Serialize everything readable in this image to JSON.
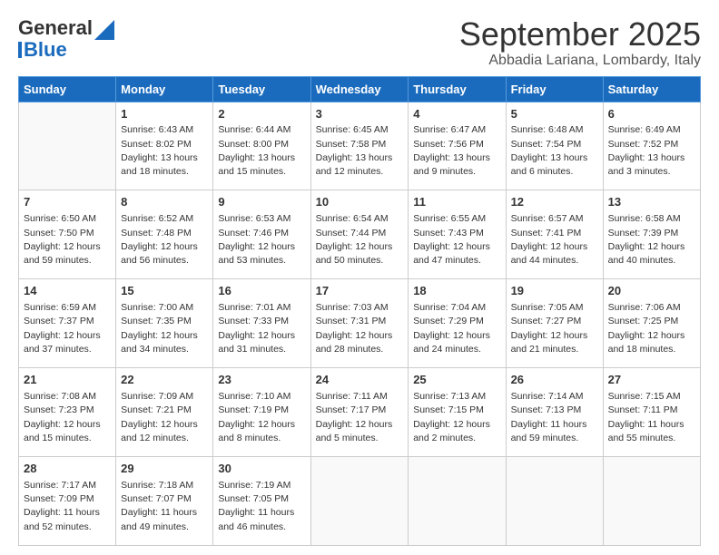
{
  "logo": {
    "line1": "General",
    "line2": "Blue"
  },
  "title": "September 2025",
  "subtitle": "Abbadia Lariana, Lombardy, Italy",
  "days_of_week": [
    "Sunday",
    "Monday",
    "Tuesday",
    "Wednesday",
    "Thursday",
    "Friday",
    "Saturday"
  ],
  "weeks": [
    [
      {
        "day": "",
        "info": ""
      },
      {
        "day": "1",
        "info": "Sunrise: 6:43 AM\nSunset: 8:02 PM\nDaylight: 13 hours\nand 18 minutes."
      },
      {
        "day": "2",
        "info": "Sunrise: 6:44 AM\nSunset: 8:00 PM\nDaylight: 13 hours\nand 15 minutes."
      },
      {
        "day": "3",
        "info": "Sunrise: 6:45 AM\nSunset: 7:58 PM\nDaylight: 13 hours\nand 12 minutes."
      },
      {
        "day": "4",
        "info": "Sunrise: 6:47 AM\nSunset: 7:56 PM\nDaylight: 13 hours\nand 9 minutes."
      },
      {
        "day": "5",
        "info": "Sunrise: 6:48 AM\nSunset: 7:54 PM\nDaylight: 13 hours\nand 6 minutes."
      },
      {
        "day": "6",
        "info": "Sunrise: 6:49 AM\nSunset: 7:52 PM\nDaylight: 13 hours\nand 3 minutes."
      }
    ],
    [
      {
        "day": "7",
        "info": "Sunrise: 6:50 AM\nSunset: 7:50 PM\nDaylight: 12 hours\nand 59 minutes."
      },
      {
        "day": "8",
        "info": "Sunrise: 6:52 AM\nSunset: 7:48 PM\nDaylight: 12 hours\nand 56 minutes."
      },
      {
        "day": "9",
        "info": "Sunrise: 6:53 AM\nSunset: 7:46 PM\nDaylight: 12 hours\nand 53 minutes."
      },
      {
        "day": "10",
        "info": "Sunrise: 6:54 AM\nSunset: 7:44 PM\nDaylight: 12 hours\nand 50 minutes."
      },
      {
        "day": "11",
        "info": "Sunrise: 6:55 AM\nSunset: 7:43 PM\nDaylight: 12 hours\nand 47 minutes."
      },
      {
        "day": "12",
        "info": "Sunrise: 6:57 AM\nSunset: 7:41 PM\nDaylight: 12 hours\nand 44 minutes."
      },
      {
        "day": "13",
        "info": "Sunrise: 6:58 AM\nSunset: 7:39 PM\nDaylight: 12 hours\nand 40 minutes."
      }
    ],
    [
      {
        "day": "14",
        "info": "Sunrise: 6:59 AM\nSunset: 7:37 PM\nDaylight: 12 hours\nand 37 minutes."
      },
      {
        "day": "15",
        "info": "Sunrise: 7:00 AM\nSunset: 7:35 PM\nDaylight: 12 hours\nand 34 minutes."
      },
      {
        "day": "16",
        "info": "Sunrise: 7:01 AM\nSunset: 7:33 PM\nDaylight: 12 hours\nand 31 minutes."
      },
      {
        "day": "17",
        "info": "Sunrise: 7:03 AM\nSunset: 7:31 PM\nDaylight: 12 hours\nand 28 minutes."
      },
      {
        "day": "18",
        "info": "Sunrise: 7:04 AM\nSunset: 7:29 PM\nDaylight: 12 hours\nand 24 minutes."
      },
      {
        "day": "19",
        "info": "Sunrise: 7:05 AM\nSunset: 7:27 PM\nDaylight: 12 hours\nand 21 minutes."
      },
      {
        "day": "20",
        "info": "Sunrise: 7:06 AM\nSunset: 7:25 PM\nDaylight: 12 hours\nand 18 minutes."
      }
    ],
    [
      {
        "day": "21",
        "info": "Sunrise: 7:08 AM\nSunset: 7:23 PM\nDaylight: 12 hours\nand 15 minutes."
      },
      {
        "day": "22",
        "info": "Sunrise: 7:09 AM\nSunset: 7:21 PM\nDaylight: 12 hours\nand 12 minutes."
      },
      {
        "day": "23",
        "info": "Sunrise: 7:10 AM\nSunset: 7:19 PM\nDaylight: 12 hours\nand 8 minutes."
      },
      {
        "day": "24",
        "info": "Sunrise: 7:11 AM\nSunset: 7:17 PM\nDaylight: 12 hours\nand 5 minutes."
      },
      {
        "day": "25",
        "info": "Sunrise: 7:13 AM\nSunset: 7:15 PM\nDaylight: 12 hours\nand 2 minutes."
      },
      {
        "day": "26",
        "info": "Sunrise: 7:14 AM\nSunset: 7:13 PM\nDaylight: 11 hours\nand 59 minutes."
      },
      {
        "day": "27",
        "info": "Sunrise: 7:15 AM\nSunset: 7:11 PM\nDaylight: 11 hours\nand 55 minutes."
      }
    ],
    [
      {
        "day": "28",
        "info": "Sunrise: 7:17 AM\nSunset: 7:09 PM\nDaylight: 11 hours\nand 52 minutes."
      },
      {
        "day": "29",
        "info": "Sunrise: 7:18 AM\nSunset: 7:07 PM\nDaylight: 11 hours\nand 49 minutes."
      },
      {
        "day": "30",
        "info": "Sunrise: 7:19 AM\nSunset: 7:05 PM\nDaylight: 11 hours\nand 46 minutes."
      },
      {
        "day": "",
        "info": ""
      },
      {
        "day": "",
        "info": ""
      },
      {
        "day": "",
        "info": ""
      },
      {
        "day": "",
        "info": ""
      }
    ]
  ]
}
